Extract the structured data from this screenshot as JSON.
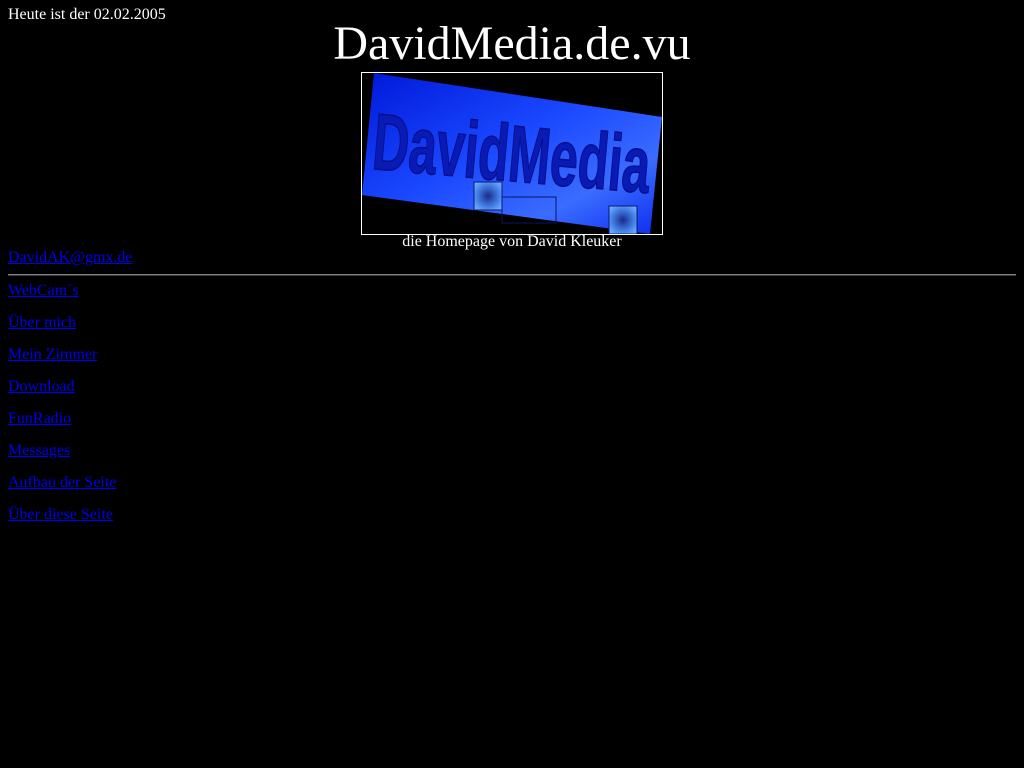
{
  "header": {
    "date_text": "Heute ist der 02.02.2005",
    "site_title": "DavidMedia.de.vu"
  },
  "logo": {
    "text": "DavidMedia"
  },
  "subtitle": "die Homepage von David Kleuker",
  "contact": {
    "email": "DavidAK@gmx.de"
  },
  "nav": {
    "items": [
      {
        "label": "WebCam´s"
      },
      {
        "label": "Über mich"
      },
      {
        "label": "Mein Zimmer"
      },
      {
        "label": "Download"
      },
      {
        "label": "FunRadio"
      },
      {
        "label": "Messages"
      },
      {
        "label": "Aufbau der Seite"
      },
      {
        "label": "Über diese Seite"
      }
    ]
  },
  "colors": {
    "background": "#000000",
    "text": "#ffffff",
    "link": "#0000ee",
    "logo_blue": "#0a2cff"
  }
}
